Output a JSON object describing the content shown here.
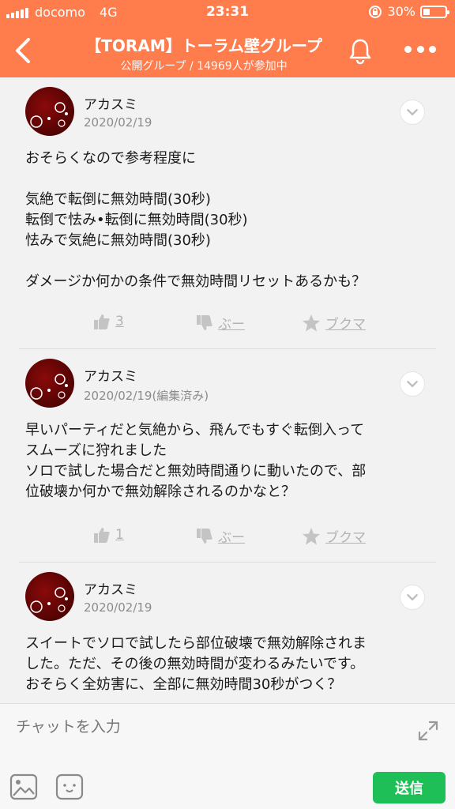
{
  "status_bar": {
    "carrier": "docomo",
    "network": "4G",
    "time": "23:31",
    "battery": "30%",
    "battery_level": 0.3
  },
  "header": {
    "title": "【TORAM】トーラム壁グループ",
    "subtitle": "公開グループ / 14969人が参加中",
    "back_icon": "chevron-left-icon",
    "bell_icon": "bell-icon",
    "more_icon": "more-dots-icon"
  },
  "posts": [
    {
      "author": "アカスミ",
      "date": "2020/02/19",
      "body": "おそらくなので参考程度に\n\n気絶で転倒に無効時間(30秒)\n転倒で怯み•転倒に無効時間(30秒)\n怯みで気絶に無効時間(30秒)\n\nダメージか何かの条件で無効時間リセットあるかも？",
      "likes": "3",
      "boo": "ぶー",
      "bookmark": "ブクマ"
    },
    {
      "author": "アカスミ",
      "date": "2020/02/19(編集済み)",
      "body": "早いパーティだと気絶から、飛んでもすぐ転倒入って\nスムーズに狩れました\nソロで試した場合だと無効時間通りに動いたので、部\n位破壊か何かで無効解除されるのかなと？",
      "likes": "1",
      "boo": "ぶー",
      "bookmark": "ブクマ"
    },
    {
      "author": "アカスミ",
      "date": "2020/02/19",
      "body": "スイートでソロで試したら部位破壊で無効解除されま\nした。ただ、その後の無効時間が変わるみたいです。\nおそらく全妨害に、全部に無効時間30秒がつく？"
    }
  ],
  "composer": {
    "placeholder": "チャットを入力",
    "send_label": "送信"
  },
  "colors": {
    "header": "#ff7c4d",
    "send": "#1fbf57",
    "muted": "#b3b3b3"
  }
}
